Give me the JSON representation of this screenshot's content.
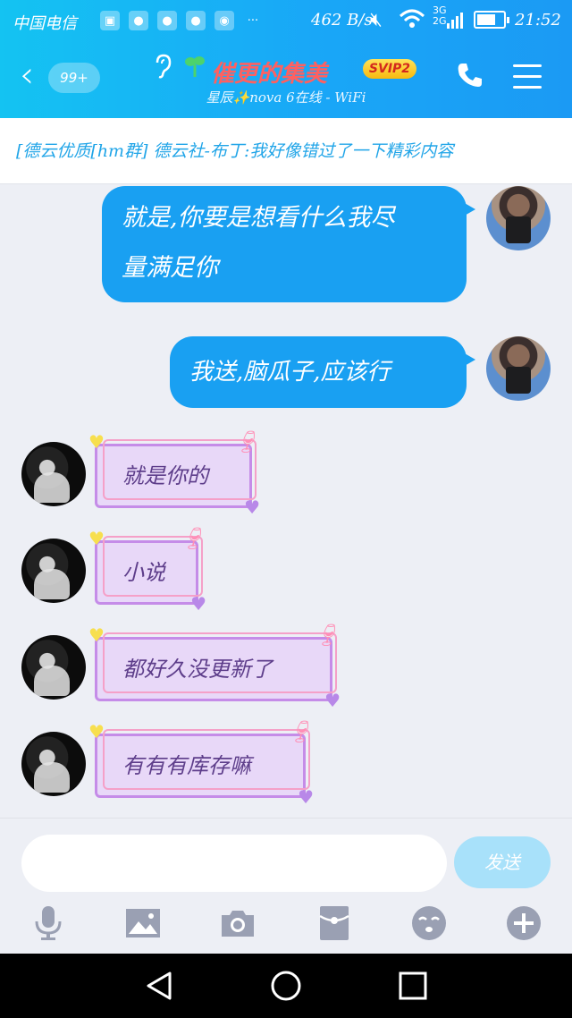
{
  "status_bar": {
    "carrier": "中国电信",
    "speed": "462 B/s",
    "network": "3G 2G",
    "time": "21:52",
    "battery_level": 0.72
  },
  "header": {
    "back_badge": "99+",
    "title": "催更的集美",
    "vip_badge": "SVIP2",
    "subtitle": "星辰✨nova 6在线 - WiFi"
  },
  "notice": "[德云优质[hm群] 德云社-布丁:我好像错过了一下精彩内容",
  "messages": [
    {
      "from": "me",
      "text_line1": "就是,你要是想看什么我尽",
      "text_line2": "量满足你"
    },
    {
      "from": "me",
      "text_line1": "我送,脑瓜子,应该行"
    },
    {
      "from": "other",
      "text": "就是你的"
    },
    {
      "from": "other",
      "text": "小说"
    },
    {
      "from": "other",
      "text": "都好久没更新了"
    },
    {
      "from": "other",
      "text": "有有有库存嘛"
    }
  ],
  "input": {
    "placeholder": "",
    "send_label": "发送"
  },
  "toolbar_icons": [
    "mic-icon",
    "image-icon",
    "camera-icon",
    "red-packet-icon",
    "emoji-icon",
    "plus-icon"
  ],
  "colors": {
    "accent": "#19a0f2",
    "other_bubble": "#e8d8f8",
    "title": "#ff6060"
  }
}
